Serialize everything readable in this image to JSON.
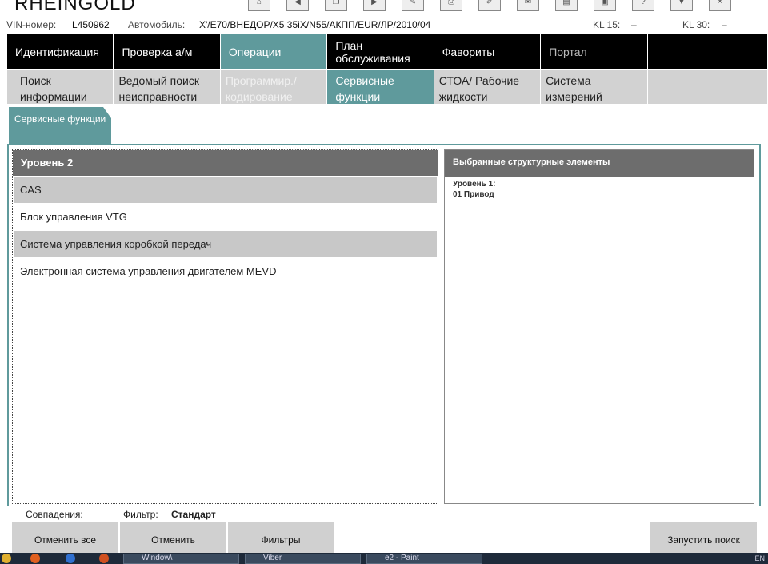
{
  "app": {
    "logo": "RHEINGOLD"
  },
  "vehicle": {
    "vin_label": "VIN-номер:",
    "vin_value": "L450962",
    "car_label": "Автомобиль:",
    "car_value": "X'/E70/ВНЕДОР/X5 35iX/N55/АКПП/EUR/ЛР/2010/04",
    "kl15_label": "KL 15:",
    "kl15_value": "–",
    "kl30_label": "KL 30:",
    "kl30_value": "–"
  },
  "nav_main": [
    "Идентификация",
    "Проверка а/м",
    "Операции",
    "План обслуживания",
    "Фавориты",
    "Портал",
    ""
  ],
  "nav_sub": [
    "Поиск информации",
    "Ведомый поиск неисправности",
    "Программир./ кодирование",
    "Сервисные функции",
    "СТОА/ Рабочие жидкости",
    "Система измерений",
    ""
  ],
  "subtab": "Сервисные функции",
  "left_panel": {
    "title": "Уровень 2",
    "items": [
      "CAS",
      "Блок управления VTG",
      "Система управления коробкой передач",
      "Электронная система управления двигателем MEVD"
    ]
  },
  "right_panel": {
    "title": "Выбранные структурные элементы",
    "lines": [
      "Уровень 1:",
      "01 Привод"
    ]
  },
  "footer": {
    "matches_label": "Совпадения:",
    "filter_label": "Фильтр:",
    "filter_value": "Стандарт"
  },
  "buttons": {
    "cancel_all": "Отменить все",
    "cancel": "Отменить",
    "filters": "Фильтры",
    "start_search": "Запустить поиск"
  },
  "taskbar": {
    "items": [
      "Window\\",
      "Viber",
      "e2 - Paint"
    ],
    "lang": "EN"
  },
  "colors": {
    "accent": "#5f9a9c",
    "tab_dark": "#000000",
    "tab_light": "#d2d2d2",
    "panel_header": "#6d6d6d"
  }
}
